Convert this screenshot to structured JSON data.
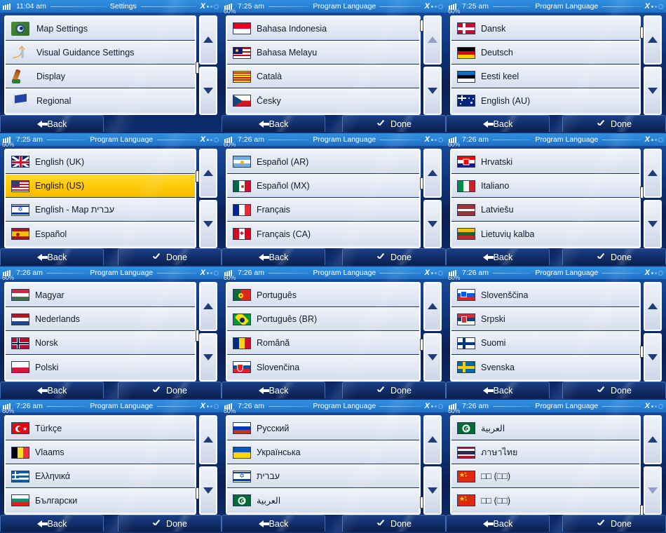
{
  "theme": {
    "accent": "#2a85d8",
    "selected_bg": "#fdc806",
    "panel_bg": "#0f3a86",
    "list_bg": "#e2e8f4"
  },
  "status": {
    "battery_pct": "60%",
    "gps_icon": "gps-no-signal-icon",
    "battery_icon": "battery-icon"
  },
  "buttons": {
    "back": "Back",
    "done": "Done",
    "back_icon": "arrow-left-icon",
    "done_icon": "check-icon"
  },
  "scroll": {
    "up_icon": "triangle-up-icon",
    "down_icon": "triangle-down-icon"
  },
  "panels": [
    {
      "time": "11:04 am",
      "title": "Settings",
      "show_pct": false,
      "has_done": false,
      "thumb_pos": 0.5,
      "up_dim": false,
      "down_dim": false,
      "items": [
        {
          "label": "Map Settings",
          "flag": "icon-map",
          "selected": false
        },
        {
          "label": "Visual Guidance Settings",
          "flag": "icon-guidance",
          "selected": false
        },
        {
          "label": "Display",
          "flag": "icon-display",
          "selected": false
        },
        {
          "label": "Regional",
          "flag": "icon-regional",
          "selected": false
        }
      ]
    },
    {
      "time": "7:25 am",
      "title": "Program Language",
      "show_pct": true,
      "has_done": true,
      "thumb_pos": 0.02,
      "up_dim": true,
      "down_dim": false,
      "items": [
        {
          "label": "Bahasa Indonesia",
          "flag": "id",
          "selected": false
        },
        {
          "label": "Bahasa Melayu",
          "flag": "my",
          "selected": false
        },
        {
          "label": "Català",
          "flag": "cat",
          "selected": false
        },
        {
          "label": "Česky",
          "flag": "cz",
          "selected": false
        }
      ]
    },
    {
      "time": "7:25 am",
      "title": "Program Language",
      "show_pct": true,
      "has_done": true,
      "thumb_pos": 0.1,
      "up_dim": false,
      "down_dim": false,
      "items": [
        {
          "label": "Dansk",
          "flag": "dk",
          "selected": false
        },
        {
          "label": "Deutsch",
          "flag": "de",
          "selected": false
        },
        {
          "label": "Eesti keel",
          "flag": "ee",
          "selected": false
        },
        {
          "label": "English (AU)",
          "flag": "au",
          "selected": false
        }
      ]
    },
    {
      "time": "7:25 am",
      "title": "Program Language",
      "show_pct": true,
      "has_done": true,
      "thumb_pos": 0.22,
      "up_dim": false,
      "down_dim": false,
      "items": [
        {
          "label": "English (UK)",
          "flag": "uk",
          "selected": false
        },
        {
          "label": "English (US)",
          "flag": "us",
          "selected": true
        },
        {
          "label": "English - Map עברית",
          "flag": "il",
          "selected": false
        },
        {
          "label": "Español",
          "flag": "es",
          "selected": false
        }
      ]
    },
    {
      "time": "7:26 am",
      "title": "Program Language",
      "show_pct": true,
      "has_done": true,
      "thumb_pos": 0.3,
      "up_dim": false,
      "down_dim": false,
      "items": [
        {
          "label": "Español (AR)",
          "flag": "ar",
          "selected": false
        },
        {
          "label": "Español (MX)",
          "flag": "mx",
          "selected": false
        },
        {
          "label": "Français",
          "flag": "fr",
          "selected": false
        },
        {
          "label": "Français (CA)",
          "flag": "ca",
          "selected": false
        }
      ]
    },
    {
      "time": "7:26 am",
      "title": "Program Language",
      "show_pct": true,
      "has_done": true,
      "thumb_pos": 0.4,
      "up_dim": false,
      "down_dim": false,
      "items": [
        {
          "label": "Hrvatski",
          "flag": "hr",
          "selected": false
        },
        {
          "label": "Italiano",
          "flag": "it",
          "selected": false
        },
        {
          "label": "Latviešu",
          "flag": "lv",
          "selected": false
        },
        {
          "label": "Lietuvių kalba",
          "flag": "lt",
          "selected": false
        }
      ]
    },
    {
      "time": "7:26 am",
      "title": "Program Language",
      "show_pct": true,
      "has_done": true,
      "thumb_pos": 0.52,
      "up_dim": false,
      "down_dim": false,
      "items": [
        {
          "label": "Magyar",
          "flag": "hu",
          "selected": false
        },
        {
          "label": "Nederlands",
          "flag": "nl",
          "selected": false
        },
        {
          "label": "Norsk",
          "flag": "no",
          "selected": false
        },
        {
          "label": "Polski",
          "flag": "pl",
          "selected": false
        }
      ]
    },
    {
      "time": "7:26 am",
      "title": "Program Language",
      "show_pct": true,
      "has_done": true,
      "thumb_pos": 0.62,
      "up_dim": false,
      "down_dim": false,
      "items": [
        {
          "label": "Português",
          "flag": "pt",
          "selected": false
        },
        {
          "label": "Português (BR)",
          "flag": "br",
          "selected": false
        },
        {
          "label": "Română",
          "flag": "ro",
          "selected": false
        },
        {
          "label": "Slovenčina",
          "flag": "sk",
          "selected": false
        }
      ]
    },
    {
      "time": "7:26 am",
      "title": "Program Language",
      "show_pct": true,
      "has_done": true,
      "thumb_pos": 0.7,
      "up_dim": false,
      "down_dim": false,
      "items": [
        {
          "label": "Slovenščina",
          "flag": "si",
          "selected": false
        },
        {
          "label": "Srpski",
          "flag": "rs",
          "selected": false
        },
        {
          "label": "Suomi",
          "flag": "fi",
          "selected": false
        },
        {
          "label": "Svenska",
          "flag": "se",
          "selected": false
        }
      ]
    },
    {
      "time": "7:26 am",
      "title": "Program Language",
      "show_pct": true,
      "has_done": true,
      "thumb_pos": 0.8,
      "up_dim": false,
      "down_dim": false,
      "items": [
        {
          "label": "Türkçe",
          "flag": "tr",
          "selected": false
        },
        {
          "label": "Vlaams",
          "flag": "be",
          "selected": false
        },
        {
          "label": "Ελληνικά",
          "flag": "gr",
          "selected": false
        },
        {
          "label": "Български",
          "flag": "bg",
          "selected": false
        }
      ]
    },
    {
      "time": "7:26 am",
      "title": "Program Language",
      "show_pct": true,
      "has_done": true,
      "thumb_pos": 0.9,
      "up_dim": false,
      "down_dim": false,
      "items": [
        {
          "label": "Русский",
          "flag": "ru",
          "selected": false
        },
        {
          "label": "Українська",
          "flag": "ua",
          "selected": false
        },
        {
          "label": "עברית",
          "flag": "il",
          "selected": false,
          "rtl": true
        },
        {
          "label": "العربية",
          "flag": "sa",
          "selected": false,
          "rtl": true
        }
      ]
    },
    {
      "time": "7:26 am",
      "title": "Program Language",
      "show_pct": true,
      "has_done": true,
      "thumb_pos": 1.0,
      "up_dim": false,
      "down_dim": true,
      "items": [
        {
          "label": "العربية",
          "flag": "sa",
          "selected": false,
          "rtl": true
        },
        {
          "label": "ภาษาไทย",
          "flag": "th",
          "selected": false
        },
        {
          "label": "□□ (□□)",
          "flag": "cn",
          "selected": false
        },
        {
          "label": "□□ (□□)",
          "flag": "cn",
          "selected": false
        }
      ]
    }
  ]
}
